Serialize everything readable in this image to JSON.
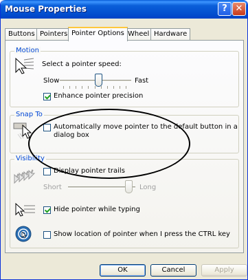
{
  "window": {
    "title": "Mouse Properties",
    "help_glyph": "?",
    "close_glyph": "✕"
  },
  "tabs": [
    {
      "label": "Buttons"
    },
    {
      "label": "Pointers"
    },
    {
      "label": "Pointer Options",
      "active": true
    },
    {
      "label": "Wheel"
    },
    {
      "label": "Hardware"
    }
  ],
  "motion": {
    "title": "Motion",
    "prompt": "Select a pointer speed:",
    "slow": "Slow",
    "fast": "Fast",
    "speed_fraction": 0.55,
    "precision_label": "Enhance pointer precision",
    "precision_checked": true
  },
  "snap_to": {
    "title": "Snap To",
    "label_line1": "Automatically move pointer to the default button in a",
    "label_line2": "dialog box",
    "checked": false
  },
  "visibility": {
    "title": "Visibility",
    "trails_label": "Display pointer trails",
    "trails_checked": false,
    "short": "Short",
    "long": "Long",
    "trail_fraction": 0.95,
    "hide_label": "Hide pointer while typing",
    "hide_checked": true,
    "ctrl_label": "Show location of pointer when I press the CTRL key",
    "ctrl_checked": false
  },
  "buttons": {
    "ok": "OK",
    "cancel": "Cancel",
    "apply": "Apply"
  },
  "colors": {
    "title_bar": "#0a5fd9",
    "group_title": "#0046d5",
    "active_tab_accent": "#ffc83c",
    "checkbox_check": "#21a121"
  },
  "annotation": {
    "shape": "hand-drawn ellipse",
    "color": "#000000"
  }
}
